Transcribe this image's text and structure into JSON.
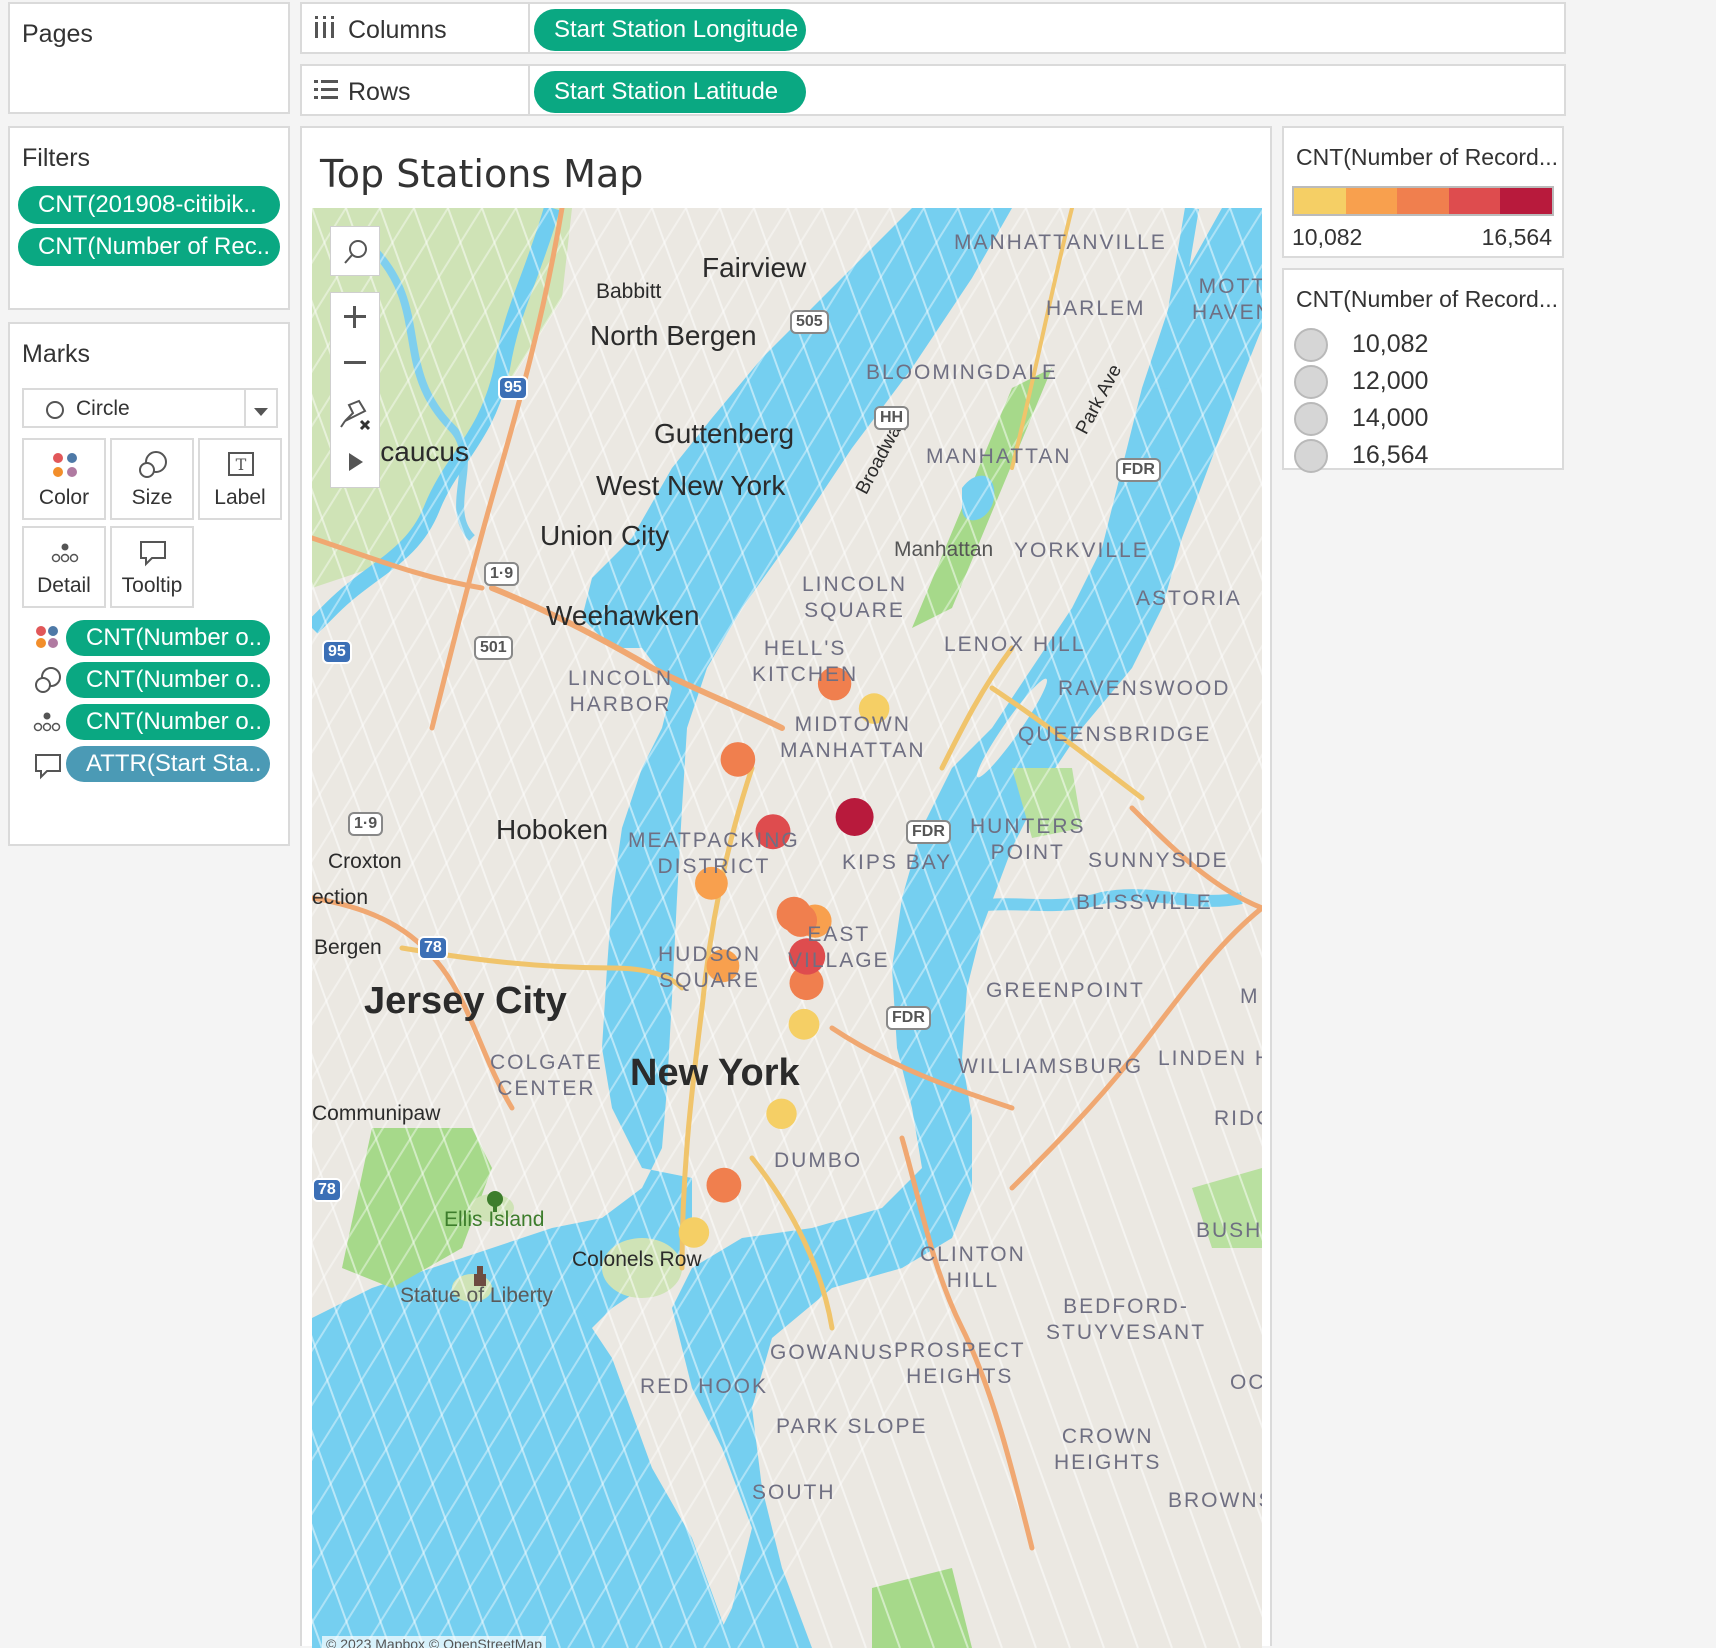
{
  "pages": {
    "title": "Pages"
  },
  "columns": {
    "label": "Columns",
    "pill": "Start Station Longitude"
  },
  "rows": {
    "label": "Rows",
    "pill": "Start Station Latitude"
  },
  "filters": {
    "title": "Filters",
    "pills": [
      "CNT(201908-citibik..",
      "CNT(Number of Rec.."
    ]
  },
  "marks": {
    "title": "Marks",
    "type": "Circle",
    "buttons": {
      "color": "Color",
      "size": "Size",
      "label": "Label",
      "detail": "Detail",
      "tooltip": "Tooltip"
    },
    "pills": [
      "CNT(Number o..",
      "CNT(Number o..",
      "CNT(Number o..",
      "ATTR(Start Sta.."
    ]
  },
  "view": {
    "title": "Top Stations Map",
    "attribution": "© 2023 Mapbox © OpenStreetMap"
  },
  "color_legend": {
    "title": "CNT(Number of Record...",
    "min": "10,082",
    "max": "16,564",
    "colors": [
      "#f5cf65",
      "#f8a04e",
      "#f07f4e",
      "#de4c4e",
      "#b81a3c"
    ]
  },
  "size_legend": {
    "title": "CNT(Number of Record...",
    "items": [
      "10,082",
      "12,000",
      "14,000",
      "16,564"
    ]
  },
  "map": {
    "labels": {
      "fairview": "Fairview",
      "babbitt": "Babbitt",
      "north_bergen": "North Bergen",
      "guttenberg": "Guttenberg",
      "west_new_york": "West New York",
      "union_city": "Union City",
      "weehawken": "Weehawken",
      "secaucus": "Secaucus",
      "hoboken": "Hoboken",
      "croxton": "Croxton",
      "ection": "ection",
      "bergen": "Bergen",
      "jersey_city": "Jersey City",
      "communipaw": "Communipaw",
      "new_york": "New York",
      "ellis_island": "Ellis Island",
      "statue": "Statue of Liberty",
      "colonels_row": "Colonels Row",
      "broadway": "Broadway",
      "park_ave": "Park Ave",
      "dumbo": "DUMBO",
      "manhattanville": "MANHATTANVILLE",
      "harlem": "HARLEM",
      "mott_haven": "MOTT\nHAVEN",
      "bloomingdale": "BLOOMINGDALE",
      "manhattan": "MANHATTAN",
      "yorkville": "YORKVILLE",
      "manhattan_small": "Manhattan",
      "lincoln_square": "LINCOLN\nSQUARE",
      "astoria": "ASTORIA",
      "hells_kitchen": "HELL'S\nKITCHEN",
      "lenox_hill": "LENOX HILL",
      "lincoln_harbor": "LINCOLN\nHARBOR",
      "ravenswood": "RAVENSWOOD",
      "midtown": "MIDTOWN\nMANHATTAN",
      "queensbridge": "QUEENSBRIDGE",
      "hunters_point": "HUNTERS\nPOINT",
      "sunnyside": "SUNNYSIDE",
      "meatpacking": "MEATPACKING\nDISTRICT",
      "kips_bay": "KIPS BAY",
      "blissville": "BLISSVILLE",
      "east_village": "EAST\nVILLAGE",
      "hudson_square": "HUDSON\nSQUARE",
      "greenpoint": "GREENPOINT",
      "colgate": "COLGATE\nCENTER",
      "williamsburg": "WILLIAMSBURG",
      "linden": "LINDEN H",
      "ridg": "RIDG",
      "bush": "BUSH",
      "clinton_hill": "CLINTON\nHILL",
      "bedford": "BEDFORD-\nSTUYVESANT",
      "gowanus": "GOWANUS",
      "prospect": "PROSPECT\nHEIGHTS",
      "red_hook": "RED HOOK",
      "park_slope": "PARK SLOPE",
      "crown": "CROWN\nHEIGHTS",
      "south": "SOUTH",
      "browns": "BROWNS",
      "oc": "OC",
      "m": "M"
    },
    "shields": {
      "i95a": "95",
      "i95b": "95",
      "r505": "505",
      "hh": "HH",
      "fdr1": "FDR",
      "fdr2": "FDR",
      "fdr3": "FDR",
      "us19a": "1·9",
      "r501": "501",
      "us19b": "1·9",
      "i78a": "78",
      "i78b": "78"
    },
    "points": [
      {
        "lat": 40.7678,
        "lon": -73.9819,
        "count": 12800
      },
      {
        "lat": 40.7649,
        "lon": -73.974,
        "count": 10500
      },
      {
        "lat": 40.759,
        "lon": -74.0012,
        "count": 13800
      },
      {
        "lat": 40.7523,
        "lon": -73.9779,
        "count": 16564
      },
      {
        "lat": 40.7506,
        "lon": -73.9942,
        "count": 14100
      },
      {
        "lat": 40.7446,
        "lon": -74.0065,
        "count": 12400
      },
      {
        "lat": 40.741,
        "lon": -73.99,
        "count": 13900
      },
      {
        "lat": 40.7402,
        "lon": -73.9858,
        "count": 12600
      },
      {
        "lat": 40.7403,
        "lon": -73.9887,
        "count": 12700
      },
      {
        "lat": 40.7361,
        "lon": -73.9874,
        "count": 15200
      },
      {
        "lat": 40.733,
        "lon": -73.9875,
        "count": 13300
      },
      {
        "lat": 40.735,
        "lon": -74.0042,
        "count": 12300
      },
      {
        "lat": 40.7282,
        "lon": -73.988,
        "count": 10700
      },
      {
        "lat": 40.7178,
        "lon": -73.9925,
        "count": 10400
      },
      {
        "lat": 40.7095,
        "lon": -74.004,
        "count": 13900
      },
      {
        "lat": 40.704,
        "lon": -74.01,
        "count": 10600
      }
    ]
  }
}
